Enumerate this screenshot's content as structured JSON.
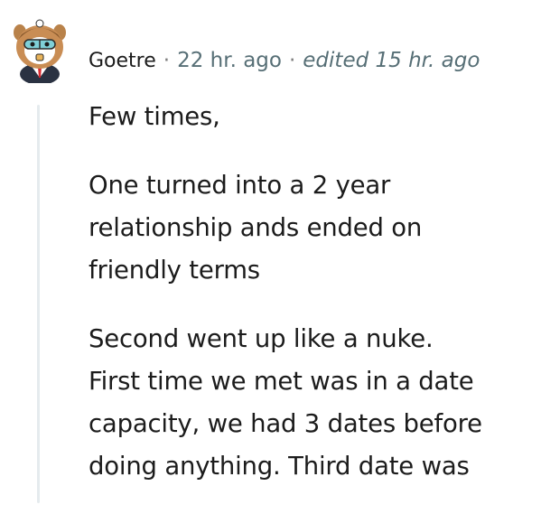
{
  "comment": {
    "author": "Goetre",
    "separator": "·",
    "posted": "22 hr. ago",
    "edited": "edited 15 hr. ago",
    "avatar_icon": "snoo-avatar-icon",
    "paragraphs": [
      "Few times,",
      "One turned into a 2 year\nrelationship ands ended on\nfriendly terms",
      "Second went up like a nuke.\nFirst time we met was in a date\ncapacity, we had 3 dates before\ndoing anything. Third date was"
    ]
  },
  "colors": {
    "text": "#1c1c1c",
    "meta": "#576f76",
    "thread_line": "#e5ebee"
  }
}
